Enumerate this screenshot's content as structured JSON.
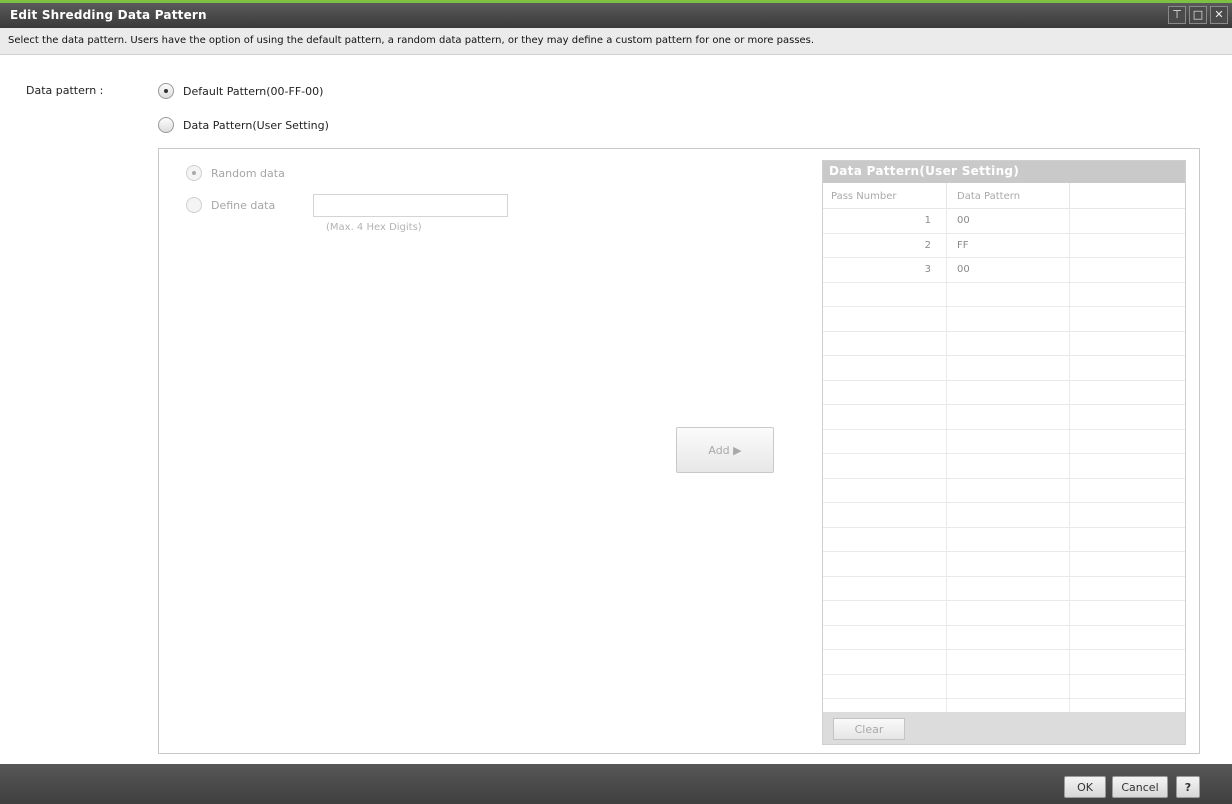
{
  "window": {
    "title": "Edit Shredding Data Pattern",
    "controls": [
      "pin-icon",
      "maximize-icon",
      "close-icon"
    ],
    "control_glyphs": {
      "pin": "⊤",
      "maximize": "□",
      "close": "✕"
    }
  },
  "description": "Select the data pattern. Users have the option of using the default pattern, a random data pattern, or they may define a custom pattern for one or more passes.",
  "form": {
    "data_pattern_label": "Data pattern :",
    "default_option": "Default Pattern(00-FF-00)",
    "user_option": "Data Pattern(User Setting)",
    "random_option": "Random data",
    "define_option": "Define data",
    "define_value": "",
    "define_hint": "(Max. 4 Hex Digits)",
    "add_label": "Add ▶"
  },
  "table": {
    "title": "Data Pattern(User Setting)",
    "columns": [
      "Pass Number",
      "Data Pattern"
    ],
    "rows": [
      [
        "1",
        "00"
      ],
      [
        "2",
        "FF"
      ],
      [
        "3",
        "00"
      ]
    ],
    "clear_label": "Clear"
  },
  "footer": {
    "ok_label": "OK",
    "cancel_label": "Cancel",
    "help_label": "?"
  },
  "colors": {
    "accent": "#7cc142",
    "titlebar": "#4a4a4a",
    "table_header": "#c9c9c9"
  }
}
